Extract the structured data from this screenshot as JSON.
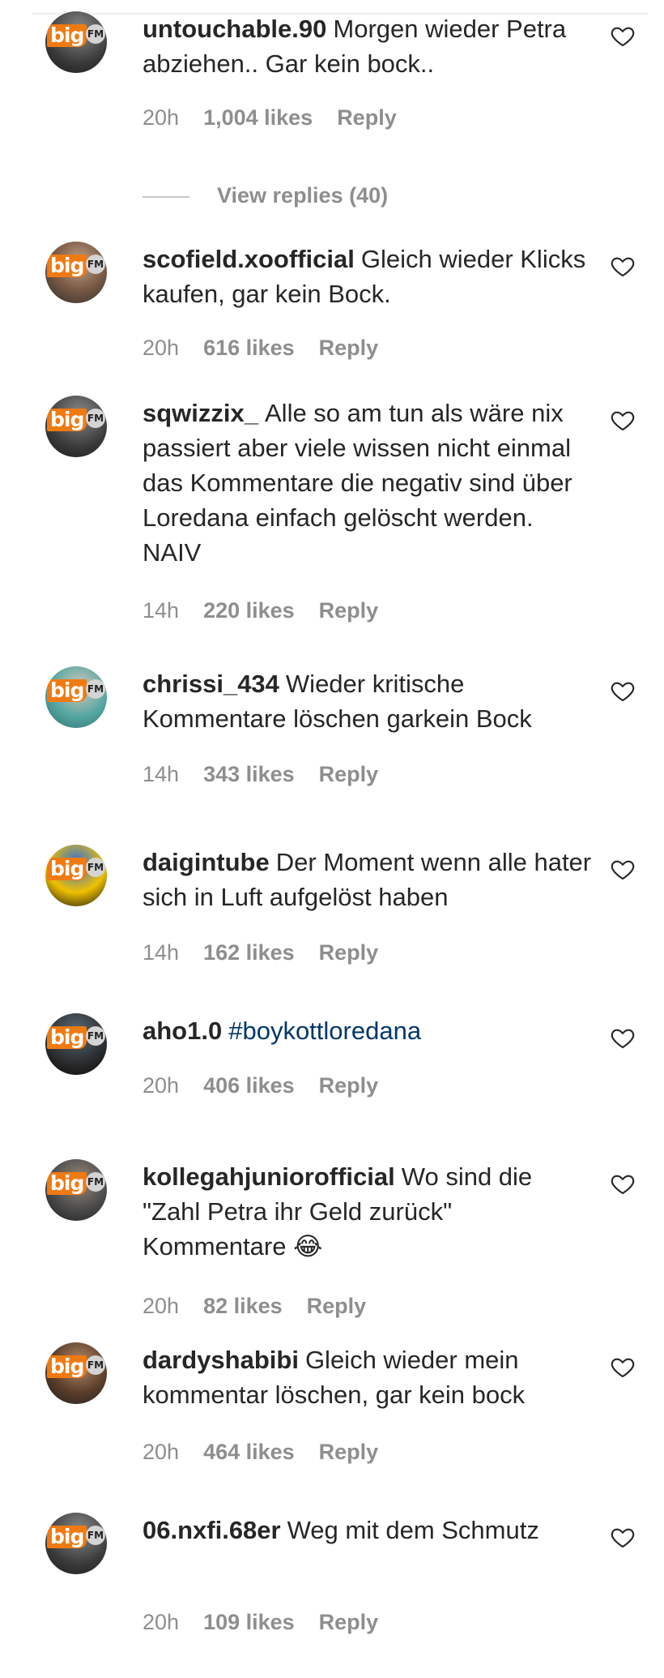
{
  "comments": [
    {
      "username": "untouchable.90",
      "text": "Morgen wieder Petra abziehen.. Gar kein bock..",
      "time": "20h",
      "likes": "1,004 likes",
      "reply": "Reply",
      "view_replies": "View replies (40)"
    },
    {
      "username": "scofield.xoofficial",
      "text": "Gleich wieder Klicks kaufen, gar kein Bock.",
      "time": "20h",
      "likes": "616 likes",
      "reply": "Reply"
    },
    {
      "username": "sqwizzix_",
      "text": "Alle so am tun als wäre nix passiert aber viele wissen nicht einmal das Kommentare die negativ sind über Loredana einfach gelöscht werden. NAIV",
      "time": "14h",
      "likes": "220 likes",
      "reply": "Reply"
    },
    {
      "username": "chrissi_434",
      "text": "Wieder kritische Kommentare löschen garkein Bock",
      "time": "14h",
      "likes": "343 likes",
      "reply": "Reply"
    },
    {
      "username": "daigintube",
      "text": "Der Moment wenn alle hater sich in Luft aufgelöst haben",
      "time": "14h",
      "likes": "162 likes",
      "reply": "Reply"
    },
    {
      "username": "aho1.0",
      "text": "#boykottloredana",
      "time": "20h",
      "likes": "406 likes",
      "reply": "Reply"
    },
    {
      "username": "kollegahjuniorofficial",
      "text": "Wo sind die \"Zahl Petra ihr Geld zurück\" Kommentare 😂",
      "time": "20h",
      "likes": "82 likes",
      "reply": "Reply"
    },
    {
      "username": "dardyshabibi",
      "text": "Gleich wieder mein kommentar löschen, gar kein bock",
      "time": "20h",
      "likes": "464 likes",
      "reply": "Reply"
    },
    {
      "username": "06.nxfi.68er",
      "text": "Weg mit dem Schmutz",
      "time": "20h",
      "likes": "109 likes",
      "reply": "Reply"
    }
  ],
  "avatar": {
    "logo": "big",
    "badge": "FM"
  },
  "icons": {
    "like": "heart-outline-icon"
  },
  "colors": {
    "hashtag": "#00376b",
    "meta": "#8e8e8e",
    "brand": "#f07a12"
  }
}
